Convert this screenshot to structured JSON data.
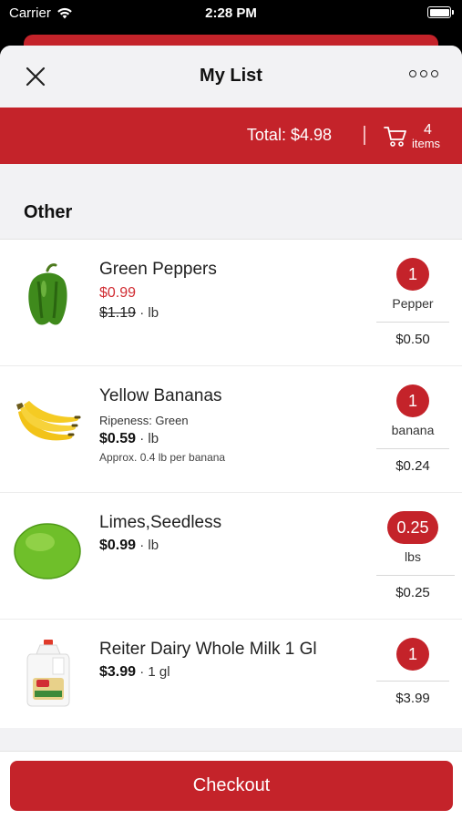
{
  "status_bar": {
    "carrier": "Carrier",
    "time": "2:28 PM"
  },
  "header": {
    "title": "My List",
    "close_icon": "close-icon",
    "more_icon": "more-icon"
  },
  "summary": {
    "total": "Total: $4.98",
    "item_count": "4",
    "items_label": "items"
  },
  "section": {
    "label": "Other"
  },
  "items": [
    {
      "name": "Green Peppers",
      "sale_price": "$0.99",
      "original_price": "$1.19",
      "price_unit": "· lb",
      "quantity": "1",
      "quantity_unit": "Pepper",
      "line_total": "$0.50",
      "image": "green-pepper"
    },
    {
      "name": "Yellow Bananas",
      "attribute": "Ripeness: Green",
      "price": "$0.59",
      "price_unit": "· lb",
      "note": "Approx. 0.4 lb per banana",
      "quantity": "1",
      "quantity_unit": "banana",
      "line_total": "$0.24",
      "image": "bananas"
    },
    {
      "name": "Limes,Seedless",
      "price": "$0.99",
      "price_unit": "· lb",
      "quantity": "0.25",
      "quantity_unit": "lbs",
      "line_total": "$0.25",
      "image": "lime"
    },
    {
      "name": "Reiter Dairy Whole Milk 1 Gl",
      "price": "$3.99",
      "price_unit": "· 1 gl",
      "quantity": "1",
      "line_total": "$3.99",
      "image": "milk-jug"
    }
  ],
  "checkout_label": "Checkout",
  "colors": {
    "accent": "#c4232a",
    "sale": "#d12d33",
    "background": "#f2f2f4"
  }
}
